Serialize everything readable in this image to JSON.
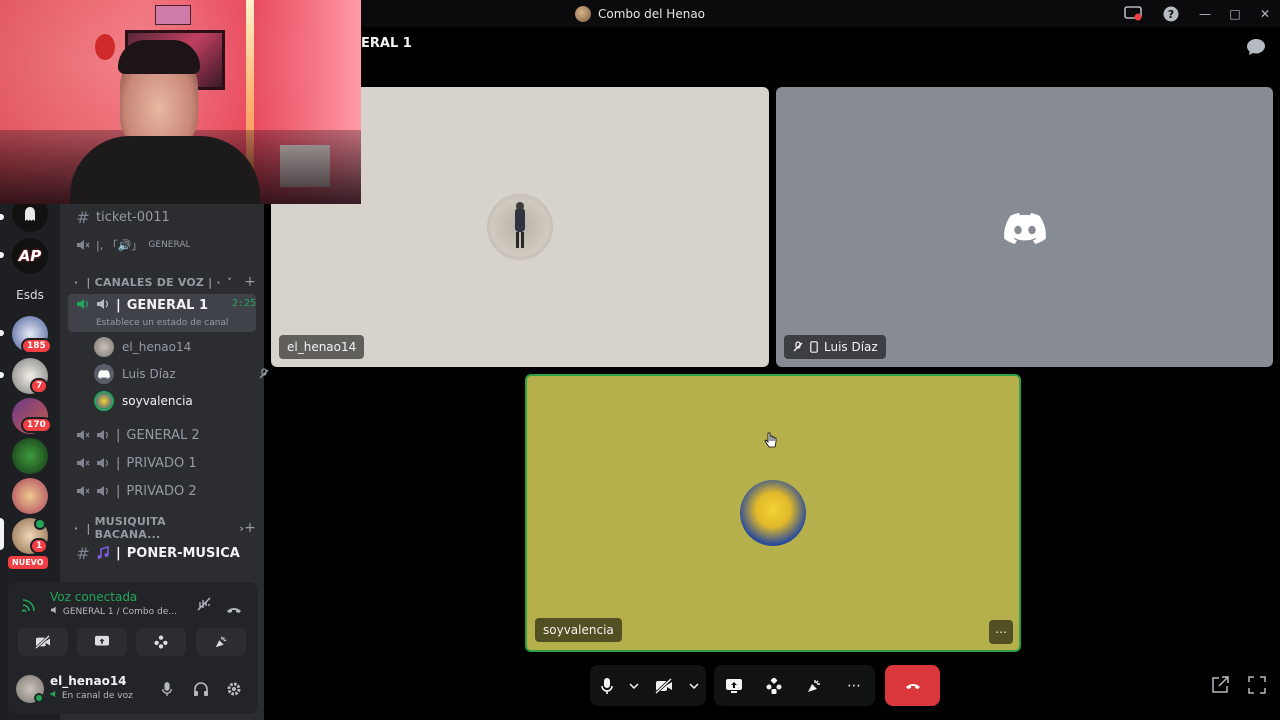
{
  "window": {
    "title": "Combo del Henao"
  },
  "rail": {
    "label_esds": "Esds",
    "badges": [
      "185",
      "7",
      "170",
      "1"
    ],
    "new_label": "NUEVO",
    "server_ap_label": "AP"
  },
  "channels": {
    "text_channel": "ticket-0011",
    "general_text": "GENERAL",
    "general_text_prefix": "|, 「🔊」",
    "voice_category": "CANALES DE VOZ",
    "active_voice": {
      "name": "GENERAL 1",
      "timer": "2:25",
      "status": "Establece un estado de canal"
    },
    "members": [
      {
        "name": "el_henao14"
      },
      {
        "name": "Luis Díaz"
      },
      {
        "name": "soyvalencia"
      }
    ],
    "voice_channels": [
      "GENERAL 2",
      "PRIVADO 1",
      "PRIVADO 2"
    ],
    "music_category": "MUSIQUITA BACANA...",
    "music_channel": "PONER-MUSICA"
  },
  "voice_panel": {
    "title": "Voz conectada",
    "subtitle": "GENERAL 1 / Combo de..."
  },
  "user_panel": {
    "name": "el_henao14",
    "status": "En canal de voz"
  },
  "main": {
    "header": "ERAL 1",
    "tiles": [
      {
        "label": "el_henao14",
        "color": "#d7d2cb"
      },
      {
        "label": "Luis Díaz",
        "color": "#878b94"
      },
      {
        "label": "soyvalencia",
        "color": "#b5b04c"
      }
    ]
  },
  "colors": {
    "accent_green": "#23a55a",
    "hangup_red": "#da373c",
    "speaking_border": "#2f9e44"
  }
}
